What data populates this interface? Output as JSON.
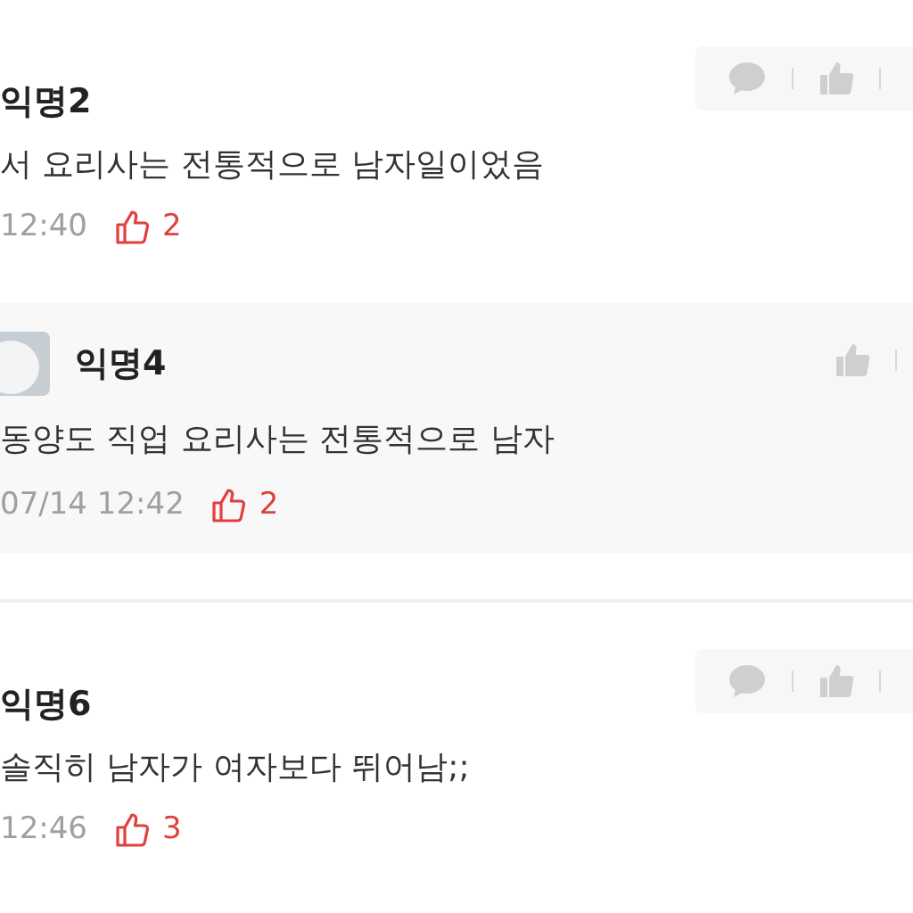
{
  "comments": [
    {
      "kind": "comment",
      "author": "익명2",
      "body": "서 요리사는 전통적으로 남자일이었음",
      "time": "12:40",
      "likes": "2"
    },
    {
      "kind": "reply",
      "author": "익명4",
      "body": "동양도 직업 요리사는 전통적으로 남자",
      "time": "07/14 12:42",
      "likes": "2"
    },
    {
      "kind": "comment",
      "author": "익명6",
      "body": "솔직히 남자가 여자보다 뛰어남;;",
      "time": "12:46",
      "likes": "3"
    }
  ]
}
